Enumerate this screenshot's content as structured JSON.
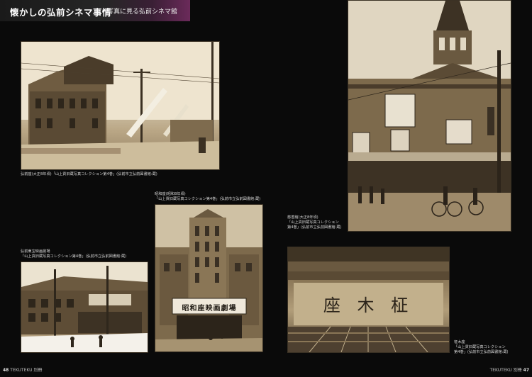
{
  "header": {
    "title": "懐かしの弘前シネマ事情",
    "subtitle": "写真に見る弘前シネマ館"
  },
  "captions": {
    "photo1": "弘前座(大正8年頃)「山上貢旧蔵写真コレクション第4巻」(弘前市立弘前図書館:蔵)",
    "photo2_line1": "弘前東宝映画劇場",
    "photo2_line2": "「山上貢旧蔵写真コレクション第4巻」(弘前市立弘前図書館:蔵)",
    "photo3_line1": "昭和座(昭和8年頃)",
    "photo3_line2": "「山上貢旧蔵写真コレクション第4巻」(弘前市立弘前図書館:蔵)",
    "photo4_line1": "慈善館(大正8年頃)",
    "photo4_line2": "「山上貢旧蔵写真コレクション",
    "photo4_line3": "第4巻」(弘前市立弘前図書館:蔵)",
    "photo5_line1": "柾木座",
    "photo5_line2": "「山上貢旧蔵写真コレクション",
    "photo5_line3": "第4巻」(弘前市立弘前図書館:蔵)"
  },
  "photo_text": {
    "showa_sign": "昭和座映画劇場",
    "masaki_banner": "座 木 柾"
  },
  "footer": {
    "left_number": "48",
    "left_label": "TEKUTEKU 別冊",
    "right_label": "TEKUTEKU 別冊",
    "right_number": "47"
  }
}
